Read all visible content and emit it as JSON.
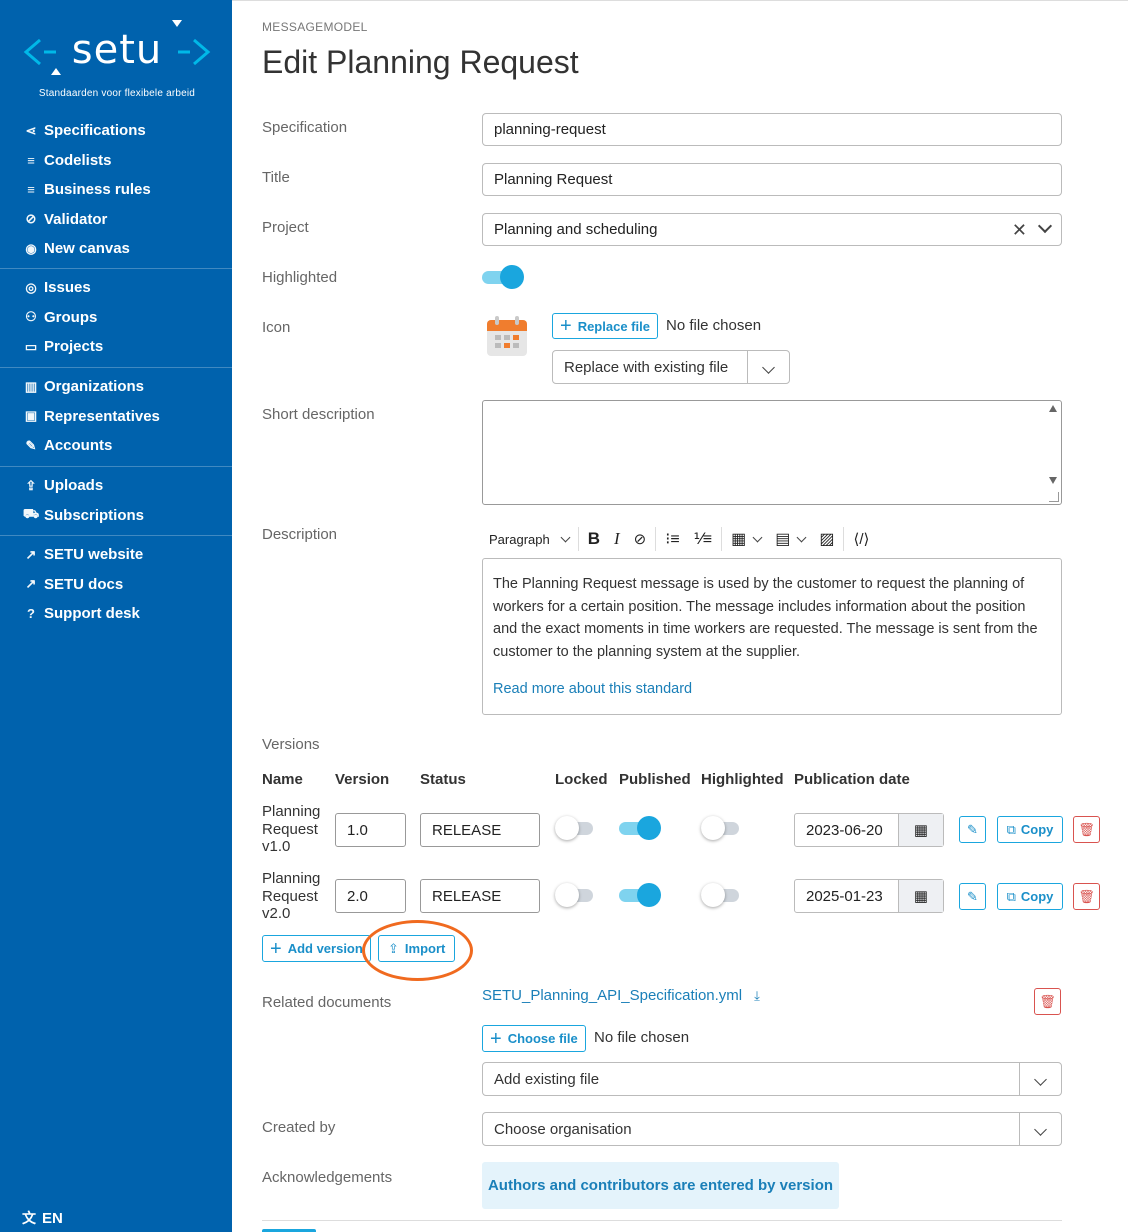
{
  "sidebar": {
    "logo_text": "setu",
    "logo_subtitle": "Standaarden voor flexibele arbeid",
    "groups": [
      [
        {
          "label": "Specifications",
          "icon": "share-icon"
        },
        {
          "label": "Codelists",
          "icon": "list-icon"
        },
        {
          "label": "Business rules",
          "icon": "list-icon"
        },
        {
          "label": "Validator",
          "icon": "check-circle-icon"
        },
        {
          "label": "New canvas",
          "icon": "eye-icon"
        }
      ],
      [
        {
          "label": "Issues",
          "icon": "issue-icon"
        },
        {
          "label": "Groups",
          "icon": "group-icon"
        },
        {
          "label": "Projects",
          "icon": "folder-icon"
        }
      ],
      [
        {
          "label": "Organizations",
          "icon": "building-icon"
        },
        {
          "label": "Representatives",
          "icon": "id-card-icon"
        },
        {
          "label": "Accounts",
          "icon": "user-edit-icon"
        }
      ],
      [
        {
          "label": "Uploads",
          "icon": "upload-icon"
        },
        {
          "label": "Subscriptions",
          "icon": "cart-icon"
        }
      ],
      [
        {
          "label": "SETU website",
          "icon": "external-link-icon"
        },
        {
          "label": "SETU docs",
          "icon": "external-link-icon"
        },
        {
          "label": "Support desk",
          "icon": "question-icon"
        }
      ]
    ],
    "language": "EN"
  },
  "header": {
    "breadcrumb": "MESSAGEMODEL",
    "title": "Edit Planning Request"
  },
  "form": {
    "specification": {
      "label": "Specification",
      "value": "planning-request"
    },
    "title": {
      "label": "Title",
      "value": "Planning Request"
    },
    "project": {
      "label": "Project",
      "value": "Planning and scheduling"
    },
    "highlighted": {
      "label": "Highlighted",
      "on": true
    },
    "icon": {
      "label": "Icon",
      "replace_button": "Replace file",
      "no_file": "No file chosen",
      "replace_existing": "Replace with existing file"
    },
    "short_description": {
      "label": "Short description",
      "value": ""
    },
    "description": {
      "label": "Description",
      "toolbar_paragraph": "Paragraph",
      "text": "The Planning Request message is used by the customer to request the planning of workers for a certain position. The message includes information about the position and the exact moments in time workers are requested. The message is sent from the customer to the planning system at the supplier.",
      "link": "Read more about this standard"
    }
  },
  "versions": {
    "label": "Versions",
    "headers": [
      "Name",
      "Version",
      "Status",
      "Locked",
      "Published",
      "Highlighted",
      "Publication date"
    ],
    "rows": [
      {
        "name_lines": [
          "Planning",
          "Request",
          "v1.0"
        ],
        "version": "1.0",
        "status": "RELEASE",
        "locked": false,
        "published": true,
        "highlighted": false,
        "date": "2023-06-20"
      },
      {
        "name_lines": [
          "Planning",
          "Request",
          "v2.0"
        ],
        "version": "2.0",
        "status": "RELEASE",
        "locked": false,
        "published": true,
        "highlighted": false,
        "date": "2025-01-23"
      }
    ],
    "copy_label": "Copy",
    "add_version": "Add version",
    "import": "Import"
  },
  "related": {
    "label": "Related documents",
    "file": "SETU_Planning_API_Specification.yml",
    "choose_button": "Choose file",
    "no_file": "No file chosen",
    "add_existing": "Add existing file"
  },
  "created_by": {
    "label": "Created by",
    "placeholder": "Choose organisation"
  },
  "acknowledgements": {
    "label": "Acknowledgements",
    "notice": "Authors and contributors are entered by version"
  },
  "colors": {
    "sidebar": "#0062ad",
    "accent": "#1aa6de",
    "link": "#1a7fb8",
    "danger": "#d9534f",
    "annotation": "#f06a1f"
  }
}
